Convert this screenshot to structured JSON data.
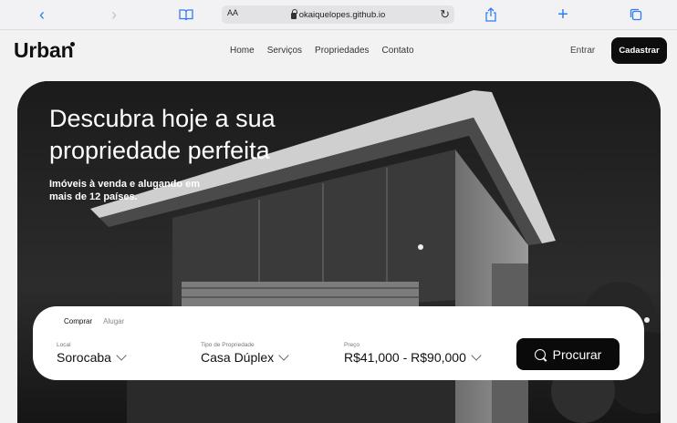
{
  "browser": {
    "text_size_label": "AA",
    "url": "okaiquelopes.github.io",
    "icons": [
      "chevron-left-icon",
      "chevron-right-icon",
      "book-icon",
      "lock-icon",
      "reload-icon",
      "share-icon",
      "plus-icon",
      "tabs-icon"
    ]
  },
  "nav": {
    "logo": "Urban",
    "links": [
      "Home",
      "Serviços",
      "Propriedades",
      "Contato"
    ],
    "login": "Entrar",
    "signup": "Cadastrar"
  },
  "hero": {
    "title": "Descubra hoje a sua propriedade perfeita",
    "subtitle": "Imóveis à venda e alugando em mais de 12 países."
  },
  "search": {
    "tabs": [
      "Comprar",
      "Alugar"
    ],
    "active_tab": "Comprar",
    "fields": [
      {
        "label": "Local",
        "value": "Sorocaba"
      },
      {
        "label": "Tipo de Propriedade",
        "value": "Casa Dúplex"
      },
      {
        "label": "Preço",
        "value": "R$41,000 - R$90,000"
      }
    ],
    "button": "Procurar"
  },
  "colors": {
    "accent_browser": "#2f7cf6",
    "button_dark": "#0d0d0d",
    "page_bg": "#f2f2f2"
  }
}
